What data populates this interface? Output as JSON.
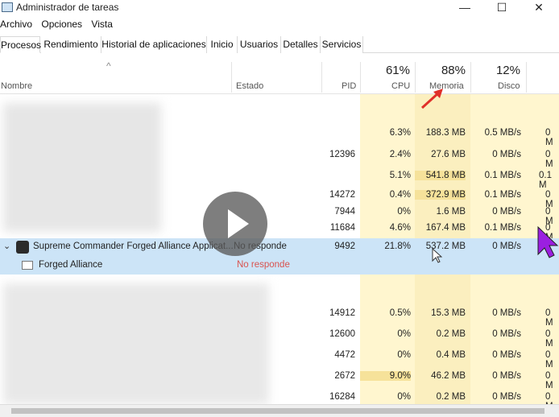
{
  "window": {
    "title": "Administrador de tareas",
    "min": "—",
    "max": "☐",
    "close": "✕"
  },
  "menu": [
    "Archivo",
    "Opciones",
    "Vista"
  ],
  "tabs": [
    "Procesos",
    "Rendimiento",
    "Historial de aplicaciones",
    "Inicio",
    "Usuarios",
    "Detalles",
    "Servicios"
  ],
  "header": {
    "sort_arrow": "^",
    "name": "Nombre",
    "status": "Estado",
    "pid": "PID",
    "cpu_pct": "61%",
    "cpu": "CPU",
    "mem_pct": "88%",
    "mem": "Memoria",
    "disk_pct": "12%",
    "disk": "Disco"
  },
  "rows": [
    {
      "pid": "",
      "cpu": "6.3%",
      "mem": "188.3 MB",
      "disk": "0.5 MB/s",
      "net": "0 M"
    },
    {
      "pid": "12396",
      "cpu": "2.4%",
      "mem": "27.6 MB",
      "disk": "0 MB/s",
      "net": "0 M"
    },
    {
      "pid": "",
      "cpu": "5.1%",
      "mem": "541.8 MB",
      "disk": "0.1 MB/s",
      "net": "0.1 M"
    },
    {
      "pid": "14272",
      "cpu": "0.4%",
      "mem": "372.9 MB",
      "disk": "0.1 MB/s",
      "net": "0 M"
    },
    {
      "pid": "7944",
      "cpu": "0%",
      "mem": "1.6 MB",
      "disk": "0 MB/s",
      "net": "0 M"
    },
    {
      "pid": "11684",
      "cpu": "4.6%",
      "mem": "167.4 MB",
      "disk": "0.1 MB/s",
      "net": "0 M"
    }
  ],
  "selected": {
    "name": "Supreme Commander Forged Alliance Applicat...",
    "status": "No responde",
    "pid": "9492",
    "cpu": "21.8%",
    "mem": "537.2 MB",
    "disk": "0 MB/s",
    "child_name": "Forged Alliance",
    "child_status": "No responde"
  },
  "rows2": [
    {
      "pid": "14912",
      "cpu": "0.5%",
      "mem": "15.3 MB",
      "disk": "0 MB/s",
      "net": "0 M"
    },
    {
      "pid": "12600",
      "cpu": "0%",
      "mem": "0.2 MB",
      "disk": "0 MB/s",
      "net": "0 M"
    },
    {
      "pid": "4472",
      "cpu": "0%",
      "mem": "0.4 MB",
      "disk": "0 MB/s",
      "net": "0 M"
    },
    {
      "pid": "2672",
      "cpu": "9.0%",
      "mem": "46.2 MB",
      "disk": "0 MB/s",
      "net": "0 M"
    },
    {
      "pid": "16284",
      "cpu": "0%",
      "mem": "0.2 MB",
      "disk": "0 MB/s",
      "net": "0 M"
    }
  ],
  "colors": {
    "cpu_bg": "#fff4c4",
    "mem_bg": "#f9eab0",
    "selected": "#cce4f7",
    "not_responding": "#d9534f"
  },
  "icons": [
    "task-manager-icon",
    "play-icon",
    "arrow-annotation-icon",
    "cursor-icon"
  ]
}
